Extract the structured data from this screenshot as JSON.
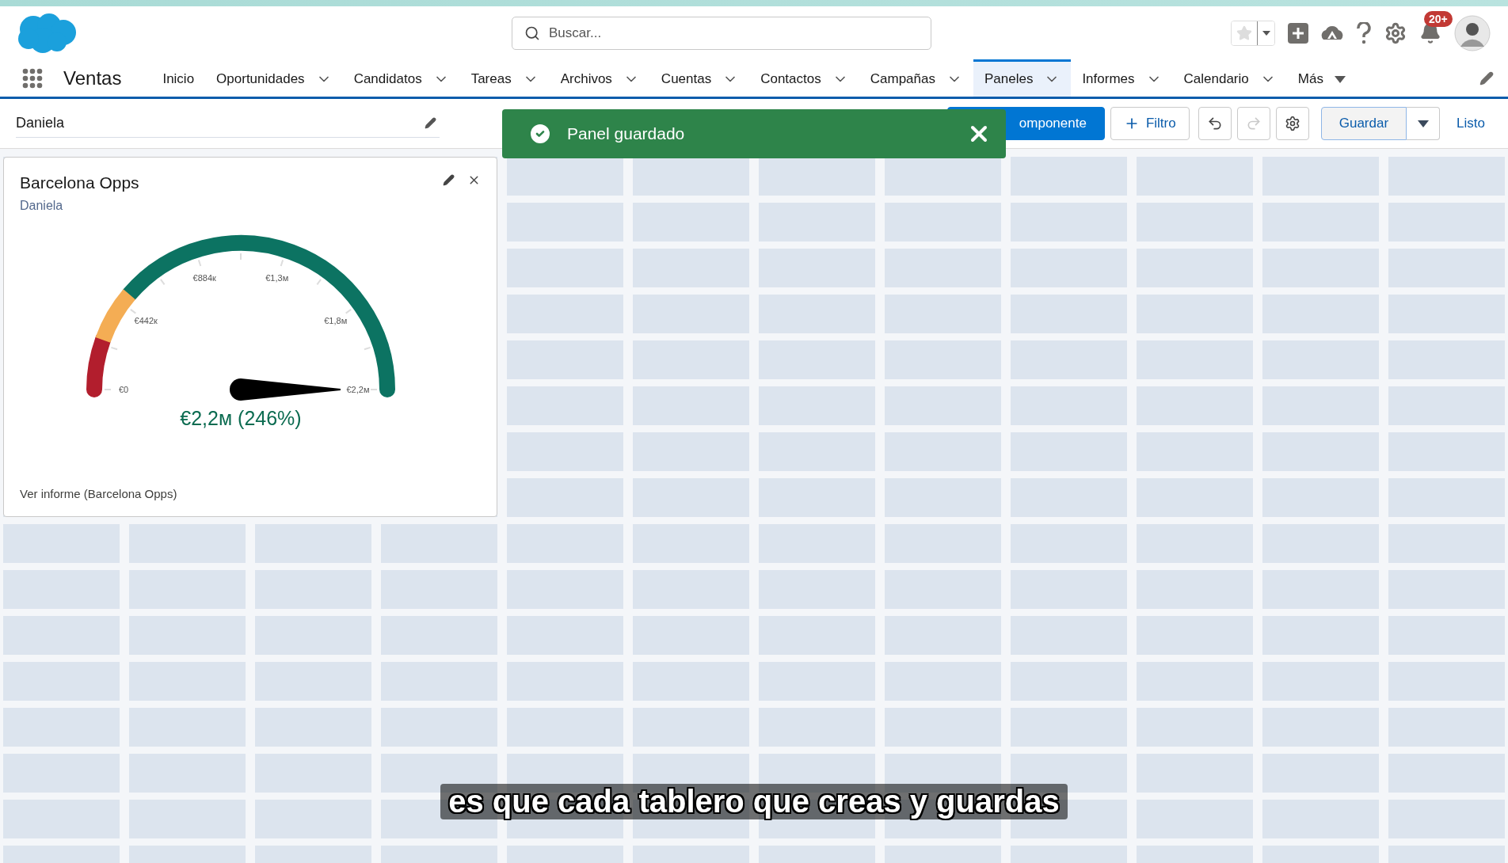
{
  "header": {
    "search": {
      "placeholder": "Buscar..."
    },
    "notifications_badge": "20+"
  },
  "nav": {
    "app_name": "Ventas",
    "items": [
      {
        "label": "Inicio",
        "selected": false,
        "kind": "plain"
      },
      {
        "label": "Oportunidades",
        "selected": false,
        "kind": "dropdown"
      },
      {
        "label": "Candidatos",
        "selected": false,
        "kind": "dropdown"
      },
      {
        "label": "Tareas",
        "selected": false,
        "kind": "dropdown"
      },
      {
        "label": "Archivos",
        "selected": false,
        "kind": "dropdown"
      },
      {
        "label": "Cuentas",
        "selected": false,
        "kind": "dropdown"
      },
      {
        "label": "Contactos",
        "selected": false,
        "kind": "dropdown"
      },
      {
        "label": "Campañas",
        "selected": false,
        "kind": "dropdown"
      },
      {
        "label": "Paneles",
        "selected": true,
        "kind": "dropdown"
      },
      {
        "label": "Informes",
        "selected": false,
        "kind": "dropdown"
      },
      {
        "label": "Calendario",
        "selected": false,
        "kind": "dropdown"
      },
      {
        "label": "Más",
        "selected": false,
        "kind": "more"
      }
    ]
  },
  "toolbar": {
    "dashboard_name": "Daniela",
    "component_button": "omponente",
    "filter_button": "Filtro",
    "icon_buttons": [
      {
        "kind": "undo",
        "disabled": false
      },
      {
        "kind": "redo",
        "disabled": true
      },
      {
        "kind": "settings",
        "disabled": false
      }
    ],
    "save_button": "Guardar",
    "done_link": "Listo"
  },
  "toast": {
    "message": "Panel guardado"
  },
  "card": {
    "title": "Barcelona Opps",
    "subtitle": "Daniela",
    "gauge": {
      "tick_labels": [
        "€0",
        "€442к",
        "€884к",
        "€1,3м",
        "€1,8м",
        "€2,2м"
      ],
      "value_label": "€2,2м (246%)"
    },
    "link": "Ver informe (Barcelona Opps)"
  },
  "caption": "es que cada tablero que creas y guardas"
}
